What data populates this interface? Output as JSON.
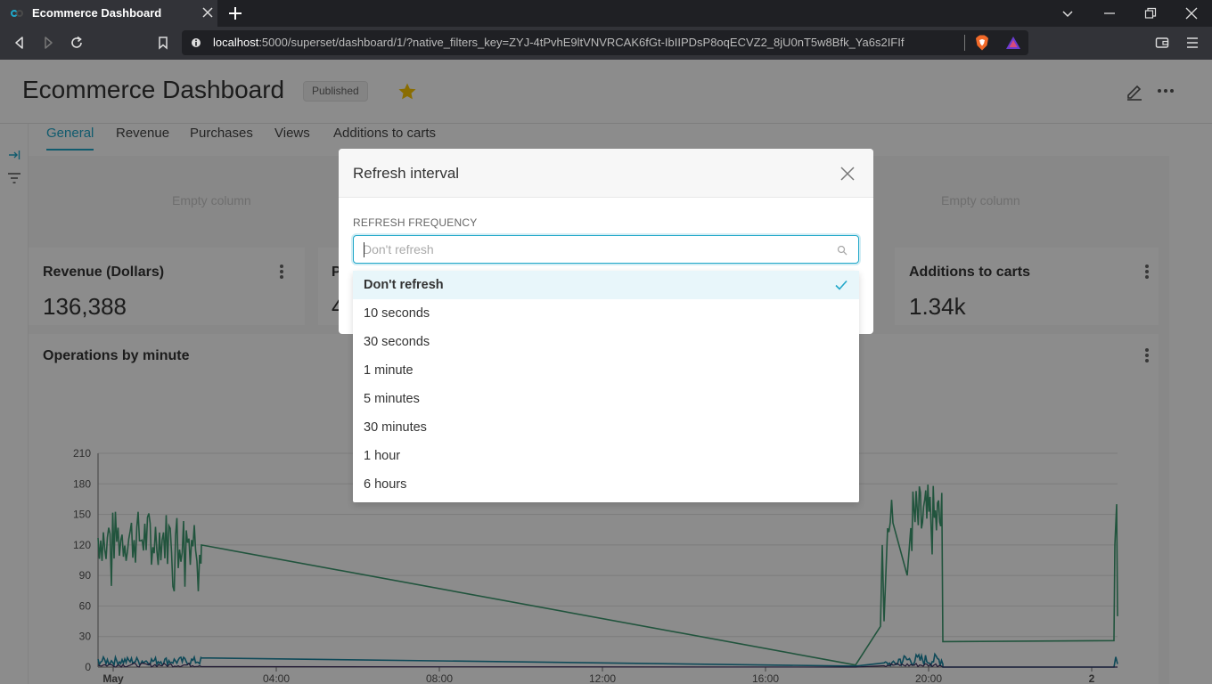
{
  "browser": {
    "tab_title": "Ecommerce Dashboard",
    "url_host": "localhost",
    "url_rest": ":5000/superset/dashboard/1/?native_filters_key=ZYJ-4tPvhE9ltVNVRCAK6fGt-IbIIPDsP8oqECVZ2_8jU0nT5w8Bfk_Ya6s2IFIf"
  },
  "dashboard": {
    "title": "Ecommerce Dashboard",
    "status_badge": "Published",
    "tabs": [
      {
        "label": "General"
      },
      {
        "label": "Revenue"
      },
      {
        "label": "Purchases"
      },
      {
        "label": "Views"
      },
      {
        "label": "Additions to carts"
      }
    ],
    "empty_column_label": "Empty column",
    "cards": [
      {
        "title": "Revenue (Dollars)",
        "value": "136,388"
      },
      {
        "title": "Additions to carts",
        "value": "1.34k"
      }
    ],
    "partial_card_title_char": "P",
    "partial_card_value_char": "4"
  },
  "chart_data": {
    "type": "line",
    "title": "Operations by minute",
    "x_tick_labels": [
      "May",
      "04:00",
      "08:00",
      "12:00",
      "16:00",
      "20:00",
      "2"
    ],
    "y_tick_labels": [
      "0",
      "30",
      "60",
      "90",
      "120",
      "150",
      "180",
      "210"
    ],
    "ylim": [
      0,
      210
    ],
    "colors": {
      "series_green": "#3d9970",
      "series_blue": "#1a85a0",
      "series_dark": "#3d2e5f"
    }
  },
  "modal": {
    "title": "Refresh interval",
    "field_label": "REFRESH FREQUENCY",
    "placeholder": "Don't refresh",
    "options": [
      {
        "label": "Don't refresh",
        "selected": true
      },
      {
        "label": "10 seconds"
      },
      {
        "label": "30 seconds"
      },
      {
        "label": "1 minute"
      },
      {
        "label": "5 minutes"
      },
      {
        "label": "30 minutes"
      },
      {
        "label": "1 hour"
      },
      {
        "label": "6 hours"
      }
    ]
  },
  "colors": {
    "accent": "#20a7c9",
    "star": "#fcc700"
  }
}
